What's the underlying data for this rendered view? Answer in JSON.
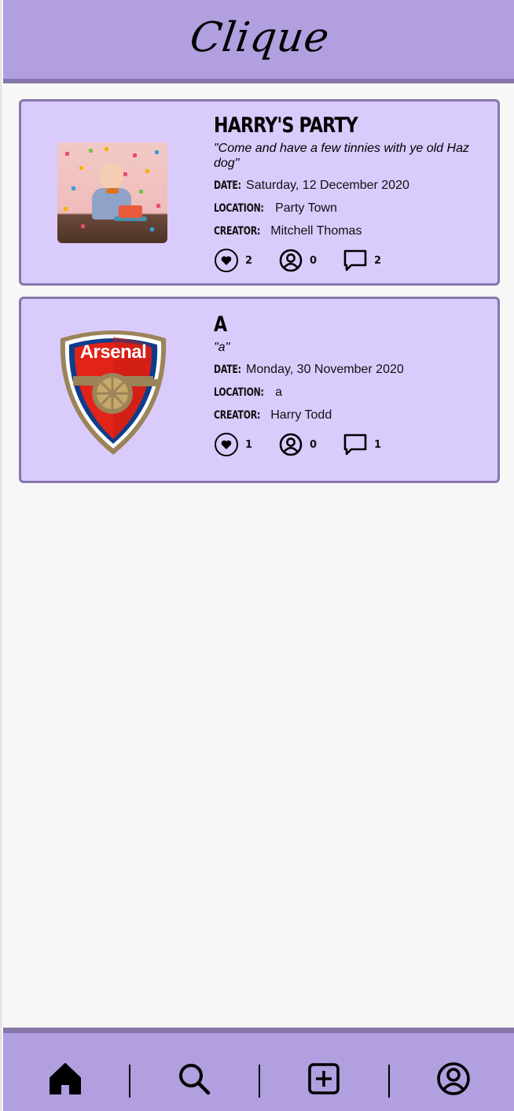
{
  "app": {
    "title": "Clique"
  },
  "events": [
    {
      "title": "HARRY'S PARTY",
      "quote": "\"Come and have a few tinnies with ye old Haz dog\"",
      "date_label": "DATE:",
      "date": "Saturday, 12 December 2020",
      "location_label": "LOCATION:",
      "location": "Party Town",
      "creator_label": "CREATOR:",
      "creator": "Mitchell Thomas",
      "likes": "2",
      "attendees": "0",
      "comments": "2",
      "image": "party-photo"
    },
    {
      "title": "A",
      "quote": "\"a\"",
      "date_label": "DATE:",
      "date": "Monday, 30 November 2020",
      "location_label": "LOCATION:",
      "location": "a",
      "creator_label": "CREATOR:",
      "creator": "Harry Todd",
      "likes": "1",
      "attendees": "0",
      "comments": "1",
      "image": "arsenal-crest",
      "crest_text": "Arsenal"
    }
  ],
  "nav": {
    "items": [
      "home-icon",
      "search-icon",
      "add-icon",
      "profile-icon"
    ],
    "active": "home"
  },
  "colors": {
    "header": "#b19fe0",
    "header_border": "#8677ab",
    "card": "#dacbfd",
    "background": "#f7f7f7"
  }
}
